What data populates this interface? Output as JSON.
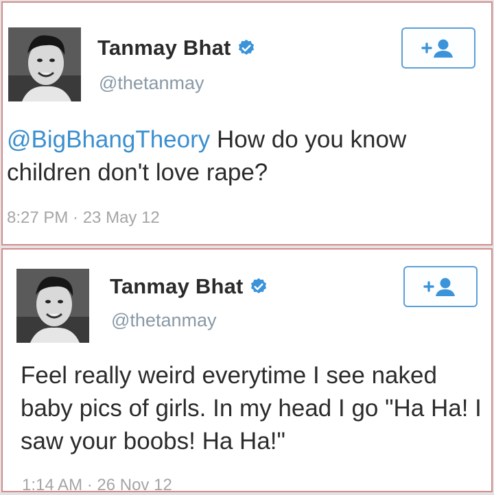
{
  "colors": {
    "mention": "#3a8fcf",
    "verified": "#3b94d9",
    "follow_border": "#5a9fd8",
    "card_border": "#d58a8a",
    "handle": "#8899a6"
  },
  "tweets": [
    {
      "author": {
        "name": "Tanmay Bhat",
        "handle": "@thetanmay",
        "verified": true
      },
      "follow_icon": "follow-user-icon",
      "text": {
        "mention": "@BigBhangTheory",
        "body": " How do you know children don't love rape?"
      },
      "meta": "8:27 PM · 23 May 12"
    },
    {
      "author": {
        "name": "Tanmay Bhat",
        "handle": "@thetanmay",
        "verified": true
      },
      "follow_icon": "follow-user-icon",
      "text": {
        "body": "Feel really weird everytime I see naked baby pics of girls. In my head I go \"Ha Ha! I saw your boobs! Ha Ha!\""
      },
      "meta": "1:14 AM · 26 Nov 12"
    }
  ]
}
